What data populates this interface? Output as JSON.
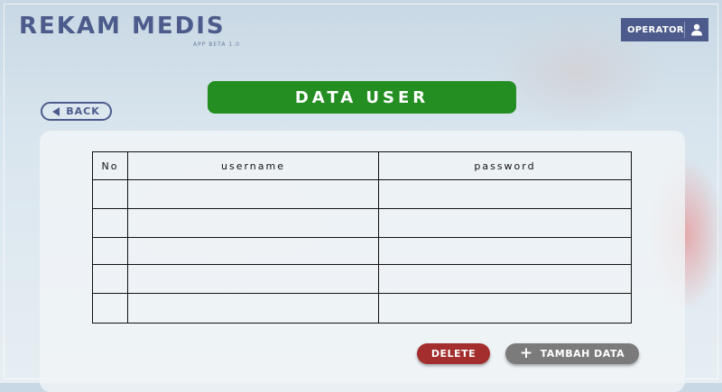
{
  "header": {
    "app_title": "REKAM MEDIS",
    "app_version": "APP BETA 1.0",
    "operator_label": "OPERATOR",
    "operator_icon": "user-icon"
  },
  "nav": {
    "back_label": "BACK",
    "back_icon": "arrow-left-icon"
  },
  "page": {
    "title": "DATA USER"
  },
  "table": {
    "columns": [
      "No",
      "username",
      "password"
    ],
    "rows": [
      [
        "",
        "",
        ""
      ],
      [
        "",
        "",
        ""
      ],
      [
        "",
        "",
        ""
      ],
      [
        "",
        "",
        ""
      ],
      [
        "",
        "",
        ""
      ]
    ]
  },
  "actions": {
    "delete_label": "DELETE",
    "add_label": "TAMBAH DATA",
    "add_icon": "plus-icon"
  },
  "colors": {
    "brand": "#4d5b8c",
    "title_green": "#248e23",
    "delete_red": "#a42d2d",
    "add_gray": "#7b7b7b"
  }
}
